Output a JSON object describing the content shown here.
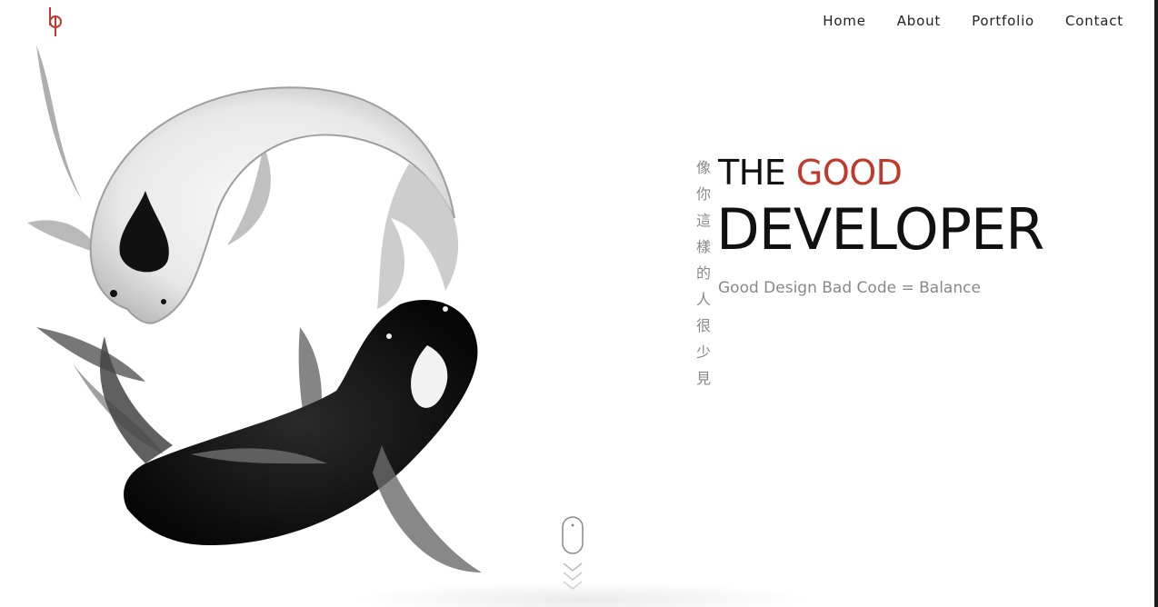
{
  "header": {
    "logo_text": "bp",
    "nav": [
      {
        "label": "Home"
      },
      {
        "label": "About"
      },
      {
        "label": "Portfolio"
      },
      {
        "label": "Contact"
      }
    ]
  },
  "hero": {
    "vertical_text": "像你這樣的人很少見",
    "title_prefix": "THE ",
    "title_accent": "GOOD",
    "title_main": "DEVELOPER",
    "tagline": "Good Design Bad Code = Balance"
  },
  "colors": {
    "accent": "#c0392b",
    "text": "#111111",
    "muted": "#888888"
  },
  "icons": {
    "scroll": "mouse-icon",
    "chevrons": "chevron-down-icon"
  }
}
